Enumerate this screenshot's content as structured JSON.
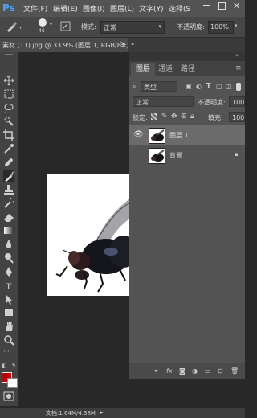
{
  "app": {
    "logo": "Ps"
  },
  "menu": [
    "文件(F)",
    "编辑(E)",
    "图像(I)",
    "图层(L)",
    "文字(Y)",
    "选择(S"
  ],
  "options": {
    "brush_size": "46",
    "mode_label": "模式:",
    "mode_value": "正常",
    "opacity_label": "不透明度:",
    "opacity_value": "100%"
  },
  "document_tab": {
    "title": "素材 (11).jpg @ 33.9% (图层 1, RGB/8#) *",
    "close": "×"
  },
  "colors": {
    "foreground": "#c00000",
    "background": "#ffffff",
    "accent": "#4ba3f5"
  },
  "tools": [
    "move-icon",
    "marquee-icon",
    "lasso-icon",
    "quick-select-icon",
    "crop-icon",
    "eyedropper-icon",
    "healing-icon",
    "brush-icon",
    "stamp-icon",
    "history-brush-icon",
    "eraser-icon",
    "gradient-icon",
    "blur-icon",
    "dodge-icon",
    "pen-icon",
    "type-icon",
    "path-select-icon",
    "shape-icon",
    "hand-icon",
    "zoom-icon"
  ],
  "panel": {
    "tabs": [
      "图层",
      "通道",
      "路径"
    ],
    "filter_kind": "类型",
    "blend_mode": "正常",
    "opacity_label": "不透明度:",
    "opacity_value": "100%",
    "lock_label": "锁定:",
    "fill_label": "填充:",
    "fill_value": "100%",
    "layers": [
      {
        "name": "图层 1",
        "visible": true,
        "selected": true
      },
      {
        "name": "背景",
        "visible": false,
        "selected": false,
        "locked": true
      }
    ],
    "footer_icons": [
      "link-icon",
      "fx-icon",
      "mask-icon",
      "adjustment-icon",
      "group-icon",
      "new-layer-icon",
      "trash-icon"
    ],
    "fx_label": "fx"
  },
  "status": {
    "doc_info": "文档:1.64M/4.38M"
  }
}
